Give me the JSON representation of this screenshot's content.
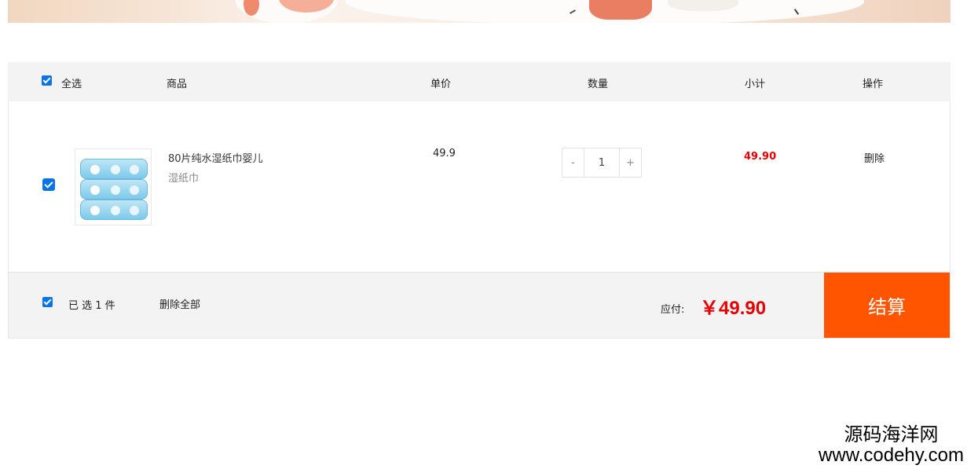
{
  "header": {
    "select_all": "全选",
    "product": "商品",
    "unit_price": "单价",
    "quantity": "数量",
    "subtotal": "小计",
    "actions": "操作"
  },
  "item": {
    "title": "80片纯水湿纸巾婴儿",
    "category": "湿纸巾",
    "price": "49.9",
    "qty_minus": "-",
    "qty_value": "1",
    "qty_plus": "+",
    "subtotal": "49.90",
    "delete": "删除",
    "image_icon": "baby-wipes-product-image"
  },
  "footer": {
    "selected_count": "已 选 1 件",
    "delete_all": "删除全部",
    "payable_label": "应付:",
    "total": "￥49.90",
    "checkout": "结算"
  },
  "watermark": {
    "cn": "源码海洋网",
    "url": "www.codehy.com"
  },
  "colors": {
    "accent_orange": "#ff5500",
    "price_red": "#e60000",
    "checkbox_blue": "#0a74e6"
  }
}
